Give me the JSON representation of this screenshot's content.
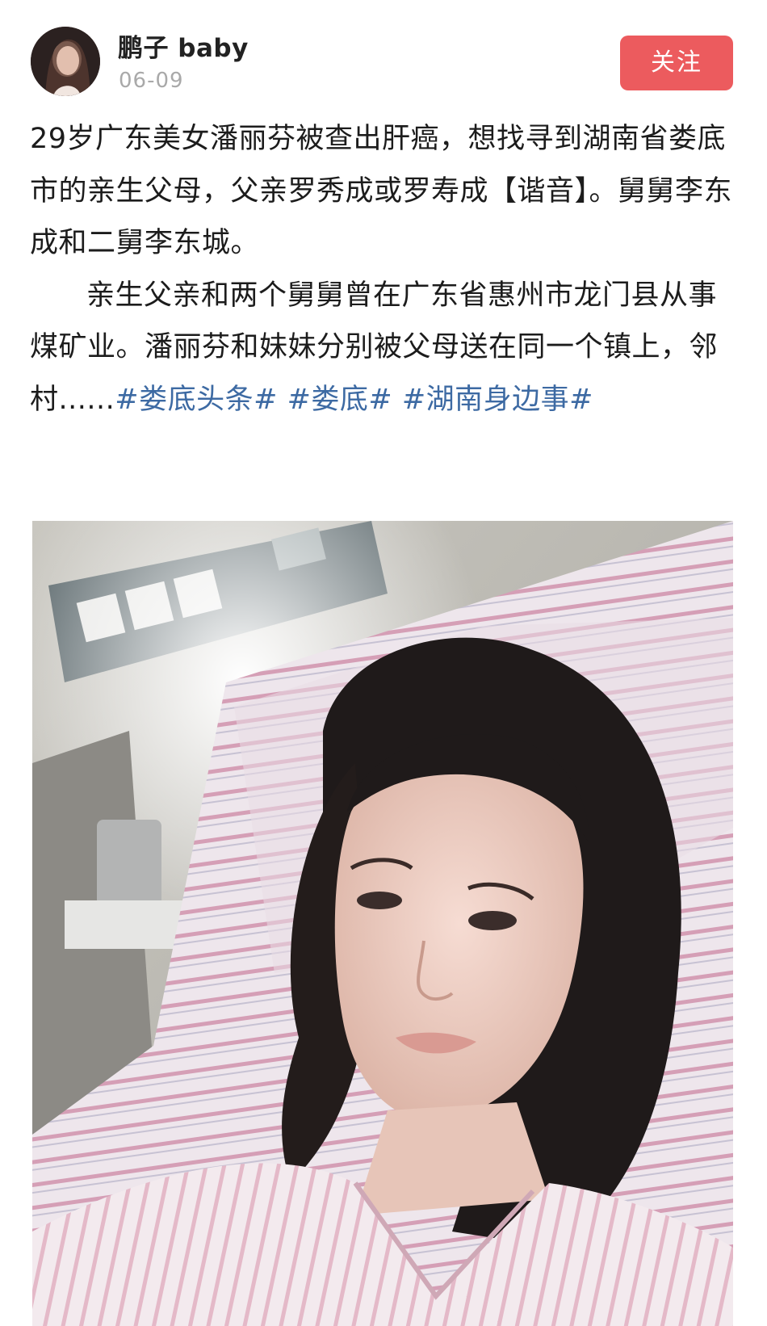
{
  "author": {
    "name": "鹏子 baby",
    "date": "06-09"
  },
  "follow_button": {
    "label": "关注",
    "color": "#ec5b5e"
  },
  "post": {
    "paragraph1": "29岁广东美女潘丽芬被查出肝癌，想找寻到湖南省娄底市的亲生父母，父亲罗秀成或罗寿成【谐音】。舅舅李东成和二舅李东城。",
    "paragraph2_text": "亲生父亲和两个舅舅曾在广东省惠州市龙门县从事煤矿业。潘丽芬和妹妹分别被父母送在同一个镇上，邻村......",
    "hashtags": [
      "#娄底头条#",
      "#娄底#",
      "#湖南身边事#"
    ],
    "hashtag_color": "#3d6aa3"
  },
  "photo": {
    "icon": "photo-selfie-hospital-bed"
  }
}
